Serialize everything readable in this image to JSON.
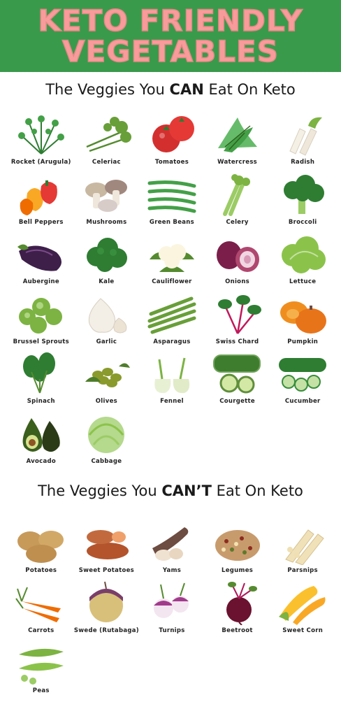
{
  "banner": {
    "line1": "KETO FRIENDLY",
    "line2": "VEGETABLES"
  },
  "can_section": {
    "prefix": "The Veggies You ",
    "emphasis": "CAN",
    "suffix": " Eat On Keto"
  },
  "cant_section": {
    "prefix": "The Veggies You ",
    "emphasis": "CAN’T",
    "suffix": " Eat On Keto"
  },
  "can_items": [
    {
      "label": "Rocket (Arugula)",
      "icon": "rocket-icon"
    },
    {
      "label": "Celeriac",
      "icon": "celeriac-icon"
    },
    {
      "label": "Tomatoes",
      "icon": "tomatoes-icon"
    },
    {
      "label": "Watercress",
      "icon": "watercress-icon"
    },
    {
      "label": "Radish",
      "icon": "radish-icon"
    },
    {
      "label": "Bell Peppers",
      "icon": "bell-peppers-icon"
    },
    {
      "label": "Mushrooms",
      "icon": "mushrooms-icon"
    },
    {
      "label": "Green Beans",
      "icon": "green-beans-icon"
    },
    {
      "label": "Celery",
      "icon": "celery-icon"
    },
    {
      "label": "Broccoli",
      "icon": "broccoli-icon"
    },
    {
      "label": "Aubergine",
      "icon": "aubergine-icon"
    },
    {
      "label": "Kale",
      "icon": "kale-icon"
    },
    {
      "label": "Cauliflower",
      "icon": "cauliflower-icon"
    },
    {
      "label": "Onions",
      "icon": "onions-icon"
    },
    {
      "label": "Lettuce",
      "icon": "lettuce-icon"
    },
    {
      "label": "Brussel Sprouts",
      "icon": "brussel-sprouts-icon"
    },
    {
      "label": "Garlic",
      "icon": "garlic-icon"
    },
    {
      "label": "Asparagus",
      "icon": "asparagus-icon"
    },
    {
      "label": "Swiss Chard",
      "icon": "swiss-chard-icon"
    },
    {
      "label": "Pumpkin",
      "icon": "pumpkin-icon"
    },
    {
      "label": "Spinach",
      "icon": "spinach-icon"
    },
    {
      "label": "Olives",
      "icon": "olives-icon"
    },
    {
      "label": "Fennel",
      "icon": "fennel-icon"
    },
    {
      "label": "Courgette",
      "icon": "courgette-icon"
    },
    {
      "label": "Cucumber",
      "icon": "cucumber-icon"
    },
    {
      "label": "Avocado",
      "icon": "avocado-icon"
    },
    {
      "label": "Cabbage",
      "icon": "cabbage-icon"
    }
  ],
  "cant_items": [
    {
      "label": "Potatoes",
      "icon": "potatoes-icon"
    },
    {
      "label": "Sweet Potatoes",
      "icon": "sweet-potatoes-icon"
    },
    {
      "label": "Yams",
      "icon": "yams-icon"
    },
    {
      "label": "Legumes",
      "icon": "legumes-icon"
    },
    {
      "label": "Parsnips",
      "icon": "parsnips-icon"
    },
    {
      "label": "Carrots",
      "icon": "carrots-icon"
    },
    {
      "label": "Swede (Rutabaga)",
      "icon": "swede-icon"
    },
    {
      "label": "Turnips",
      "icon": "turnips-icon"
    },
    {
      "label": "Beetroot",
      "icon": "beetroot-icon"
    },
    {
      "label": "Sweet Corn",
      "icon": "sweet-corn-icon"
    },
    {
      "label": "Peas",
      "icon": "peas-icon"
    }
  ],
  "colors": {
    "banner_bg": "#3a9a4c",
    "banner_text": "#f79c9b"
  }
}
